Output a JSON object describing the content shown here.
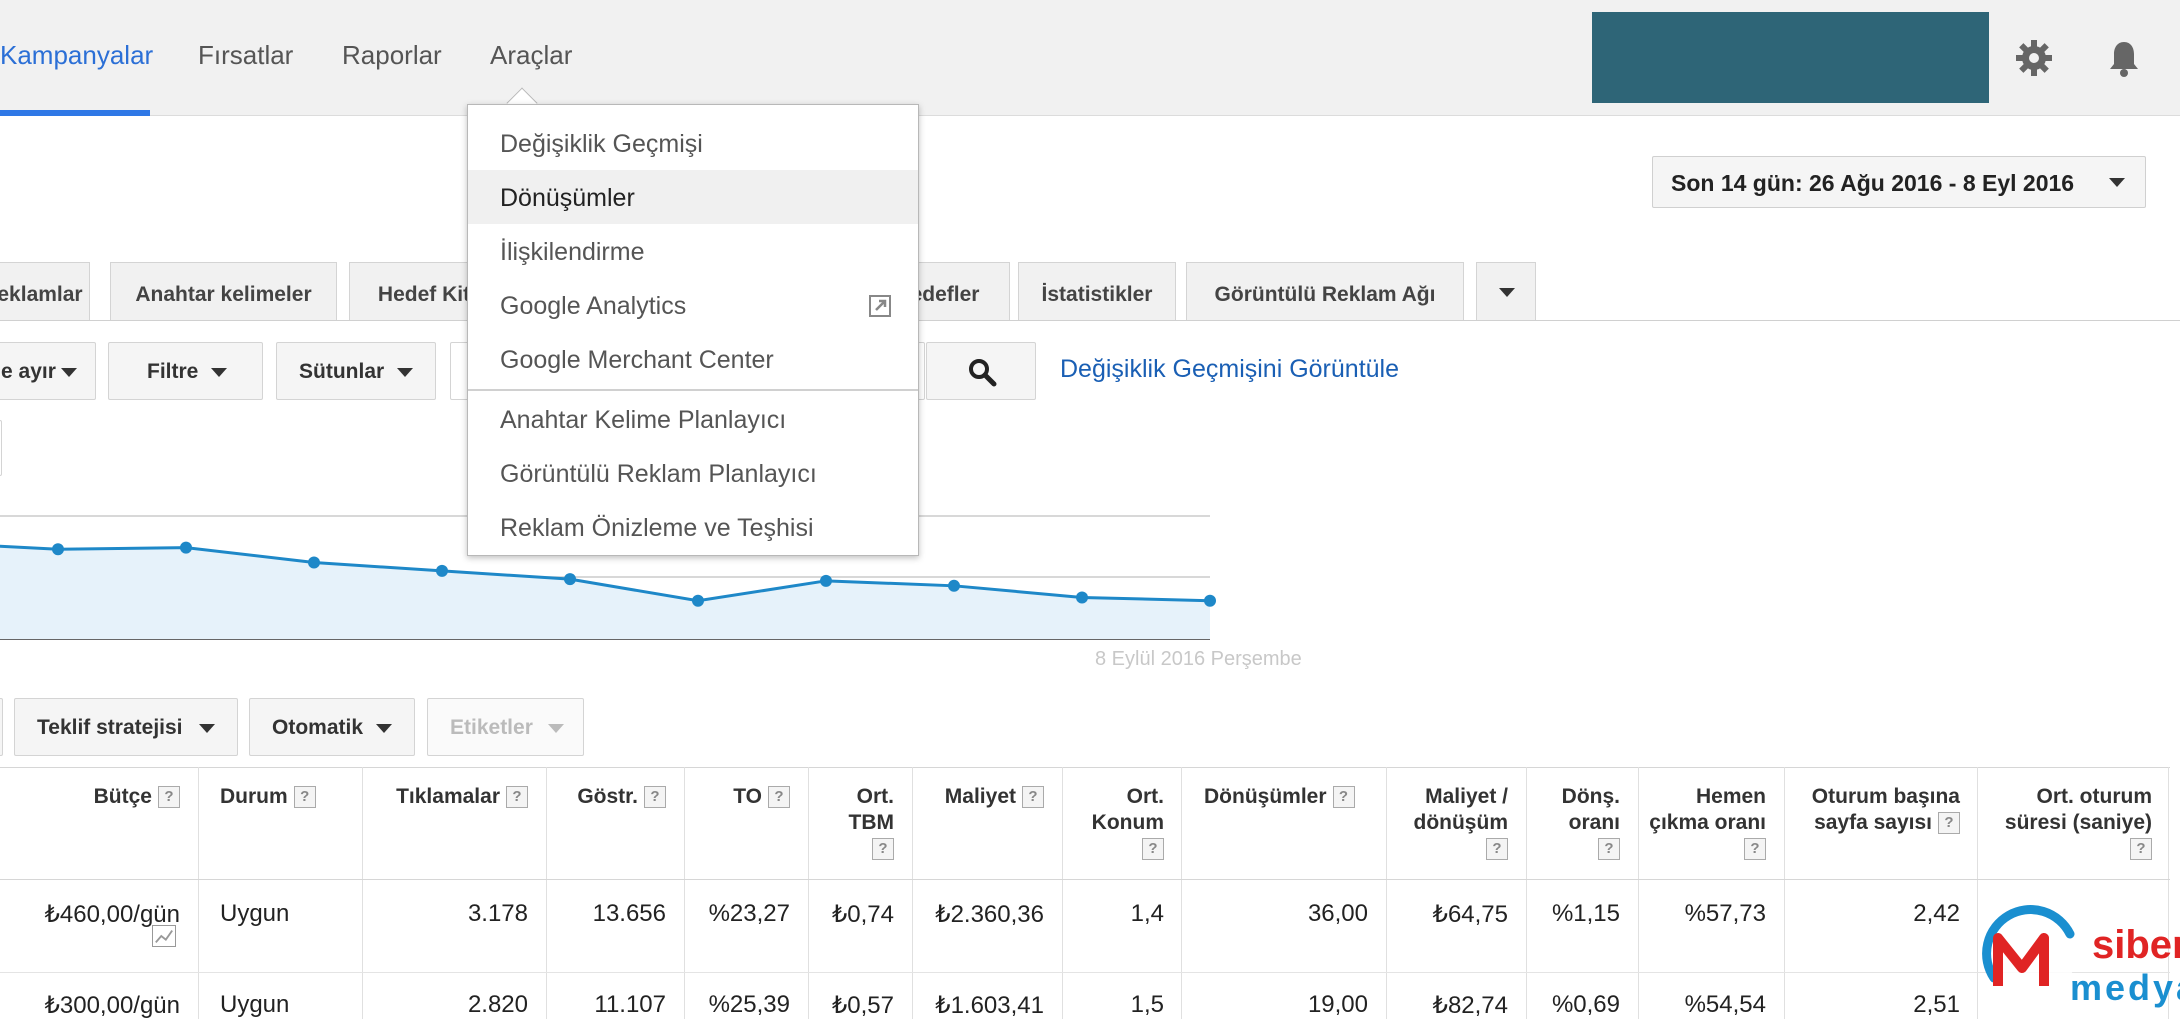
{
  "nav": {
    "tabs": [
      "Kampanyalar",
      "Fırsatlar",
      "Raporlar",
      "Araçlar"
    ],
    "active": "Kampanyalar"
  },
  "date_range": {
    "label": "Son 14 gün: 26 Ağu 2016 - 8 Eyl 2016"
  },
  "subtabs": [
    "eklamlar",
    "Anahtar kelimeler",
    "Hedef Kit",
    "edefler",
    "İstatistikler",
    "Görüntülü Reklam Ağı"
  ],
  "toolbar": {
    "segment_label": "e ayır",
    "filter_label": "Filtre",
    "columns_label": "Sütunlar",
    "history_link": "Değişiklik Geçmişini Görüntüle"
  },
  "chart": {
    "date_label": "8 Eylül 2016 Perşembe"
  },
  "chart_data": {
    "type": "area",
    "values": [
      58,
      54,
      55,
      46,
      41,
      36,
      23,
      35,
      32,
      25,
      23
    ]
  },
  "bidding": {
    "strategy_label": "Teklif stratejisi",
    "auto_label": "Otomatik",
    "labels_label": "Etiketler"
  },
  "menu": {
    "items": [
      "Değişiklik Geçmişi",
      "Dönüşümler",
      "İlişkilendirme",
      "Google Analytics",
      "Google Merchant Center",
      "Anahtar Kelime Planlayıcı",
      "Görüntülü Reklam Planlayıcı",
      "Reklam Önizleme ve Teşhisi"
    ],
    "highlighted": "Dönüşümler"
  },
  "table": {
    "help_glyph": "?",
    "headers": [
      {
        "text": "Bütçe"
      },
      {
        "text": "Durum"
      },
      {
        "text": "Tıklamalar"
      },
      {
        "text": "Göstr."
      },
      {
        "text": "TO"
      },
      {
        "text": "Ort. TBM"
      },
      {
        "text": "Maliyet"
      },
      {
        "text": "Ort. Konum"
      },
      {
        "text": "Dönüşümler"
      },
      {
        "text": "Maliyet / dönüşüm"
      },
      {
        "text": "Dönş. oranı"
      },
      {
        "text": "Hemen çıkma oranı"
      },
      {
        "text": "Oturum başına sayfa sayısı"
      },
      {
        "text": "Ort. oturum süresi (saniye)"
      }
    ],
    "rows": [
      [
        "₺460,00/gün",
        "Uygun",
        "3.178",
        "13.656",
        "%23,27",
        "₺0,74",
        "₺2.360,36",
        "1,4",
        "36,00",
        "₺64,75",
        "%1,15",
        "%57,73",
        "2,42"
      ],
      [
        "₺300,00/gün",
        "Uygun",
        "2.820",
        "11.107",
        "%25,39",
        "₺0,57",
        "₺1.603,41",
        "1,5",
        "19,00",
        "₺82,74",
        "%0,69",
        "%54,54",
        "2,51"
      ]
    ]
  },
  "logo": {
    "line1": "siber",
    "line2": "medya"
  },
  "colors": {
    "accent": "#2f78e6",
    "account": "#2e6577",
    "chart_line": "#1e88c8",
    "link": "#1a5fb4"
  }
}
